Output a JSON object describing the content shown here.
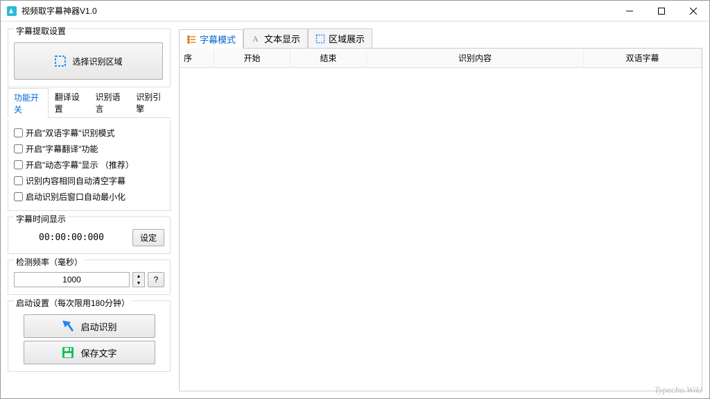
{
  "window": {
    "title": "视频取字幕神器V1.0"
  },
  "left": {
    "extract_group_title": "字幕提取设置",
    "select_region_btn": "选择识别区域",
    "settings_tabs": [
      "功能开关",
      "翻译设置",
      "识别语言",
      "识别引擎"
    ],
    "checkboxes": [
      "开启\"双语字幕\"识别模式",
      "开启\"字幕翻译\"功能",
      "开启\"动态字幕\"显示 （推荐）",
      "识别内容相同自动清空字幕",
      "启动识别后窗口自动最小化"
    ],
    "time_group_title": "字幕时间显示",
    "time_value": "00:00:00:000",
    "set_btn": "设定",
    "freq_group_title": "检测频率（毫秒）",
    "freq_value": "1000",
    "help_btn": "?",
    "start_group_title": "启动设置（每次限用180分钟）",
    "start_btn": "启动识别",
    "save_btn": "保存文字"
  },
  "right": {
    "tabs": [
      "字幕模式",
      "文本显示",
      "区域展示"
    ],
    "columns": {
      "seq": "序",
      "start": "开始",
      "end": "结束",
      "content": "识别内容",
      "bilingual": "双语字幕"
    }
  },
  "watermark": "Typecho.Wiki"
}
